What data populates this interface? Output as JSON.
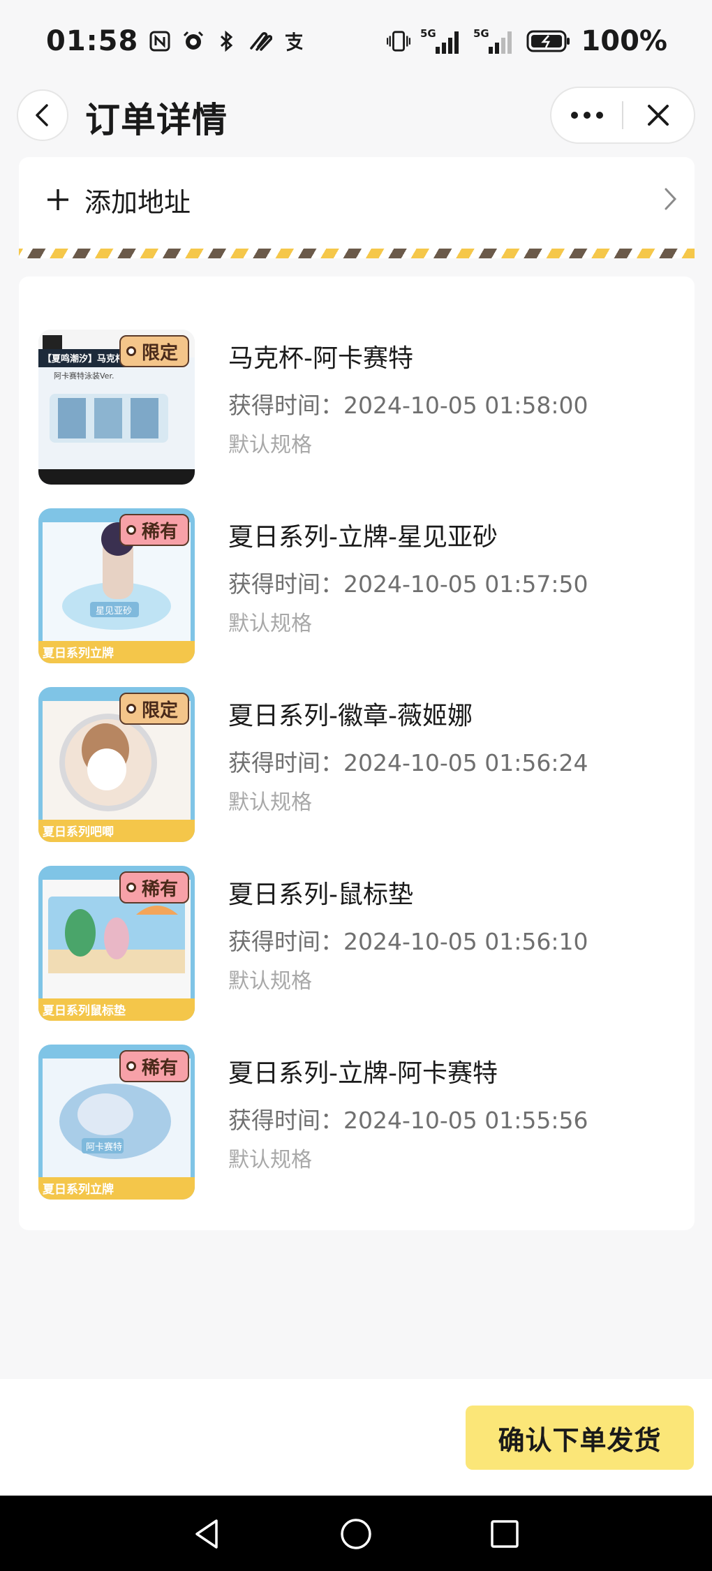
{
  "status_bar": {
    "time": "01:58",
    "left_icons": [
      "nfc-icon",
      "alarm-icon",
      "bluetooth-icon",
      "hand-icon",
      "alipay-icon"
    ],
    "network_1": "5G",
    "network_2": "5G",
    "battery": "100%"
  },
  "header": {
    "title": "订单详情"
  },
  "address": {
    "label": "添加地址"
  },
  "items": [
    {
      "title": "马克杯-阿卡赛特",
      "time": "获得时间：2024-10-05 01:58:00",
      "spec": "默认规格",
      "badge": "限定",
      "thumb_text_1": "【夏鸣潮汐】马克杯",
      "thumb_text_2": "阿卡赛特泳装Ver."
    },
    {
      "title": "夏日系列-立牌-星见亚砂",
      "time": "获得时间：2024-10-05 01:57:50",
      "spec": "默认规格",
      "badge": "稀有",
      "thumb_banner": "夏日系列立牌",
      "thumb_tag": "星见亚砂"
    },
    {
      "title": "夏日系列-徽章-薇姬娜",
      "time": "获得时间：2024-10-05 01:56:24",
      "spec": "默认规格",
      "badge": "限定",
      "thumb_banner": "夏日系列吧唧"
    },
    {
      "title": "夏日系列-鼠标垫",
      "time": "获得时间：2024-10-05 01:56:10",
      "spec": "默认规格",
      "badge": "稀有",
      "thumb_banner": "夏日系列鼠标垫"
    },
    {
      "title": "夏日系列-立牌-阿卡赛特",
      "time": "获得时间：2024-10-05 01:55:56",
      "spec": "默认规格",
      "badge": "稀有",
      "thumb_banner": "夏日系列立牌",
      "thumb_tag": "阿卡赛特"
    }
  ],
  "footer": {
    "confirm_label": "确认下单发货"
  },
  "colors": {
    "accent_yellow": "#fbe678",
    "badge_limited": "#f4c58a",
    "badge_rare": "#f7a1a8",
    "page_bg": "#f7f7f8"
  }
}
